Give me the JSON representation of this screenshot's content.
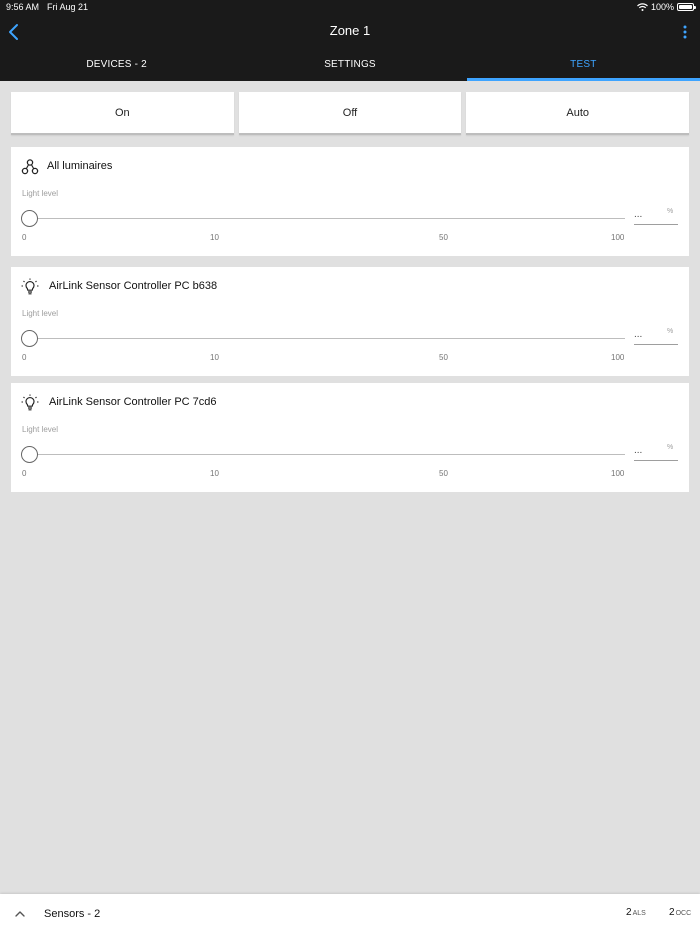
{
  "status": {
    "time": "9:56 AM",
    "date": "Fri Aug 21",
    "battery": "100%"
  },
  "header": {
    "title": "Zone 1"
  },
  "tabs": [
    {
      "label": "DEVICES - 2",
      "active": false
    },
    {
      "label": "SETTINGS",
      "active": false
    },
    {
      "label": "TEST",
      "active": true
    }
  ],
  "modes": {
    "on": "On",
    "off": "Off",
    "auto": "Auto"
  },
  "cards": [
    {
      "name": "All luminaires",
      "icon": "luminaires-group-icon",
      "light_label": "Light level",
      "value": "...",
      "unit": "%",
      "ticks": [
        "0",
        "10",
        "50",
        "100"
      ]
    },
    {
      "name": "AirLink Sensor Controller PC b638",
      "icon": "lightbulb-icon",
      "light_label": "Light level",
      "value": "...",
      "unit": "%",
      "ticks": [
        "0",
        "10",
        "50",
        "100"
      ]
    },
    {
      "name": "AirLink Sensor Controller PC 7cd6",
      "icon": "lightbulb-icon",
      "light_label": "Light level",
      "value": "...",
      "unit": "%",
      "ticks": [
        "0",
        "10",
        "50",
        "100"
      ]
    }
  ],
  "footer": {
    "label": "Sensors - 2",
    "als_count": "2",
    "als_label": "ALS",
    "occ_count": "2",
    "occ_label": "OCC"
  },
  "colors": {
    "accent": "#3ea4ff",
    "bar": "#1a1a1a",
    "background": "#e0e0e0"
  }
}
